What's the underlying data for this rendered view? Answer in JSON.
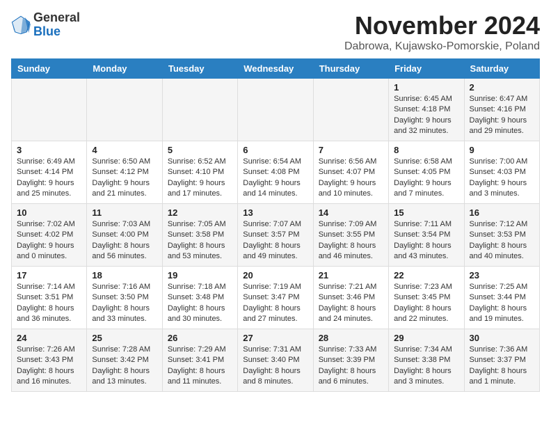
{
  "logo": {
    "general": "General",
    "blue": "Blue"
  },
  "header": {
    "month": "November 2024",
    "location": "Dabrowa, Kujawsko-Pomorskie, Poland"
  },
  "weekdays": [
    "Sunday",
    "Monday",
    "Tuesday",
    "Wednesday",
    "Thursday",
    "Friday",
    "Saturday"
  ],
  "weeks": [
    [
      {
        "day": "",
        "info": ""
      },
      {
        "day": "",
        "info": ""
      },
      {
        "day": "",
        "info": ""
      },
      {
        "day": "",
        "info": ""
      },
      {
        "day": "",
        "info": ""
      },
      {
        "day": "1",
        "info": "Sunrise: 6:45 AM\nSunset: 4:18 PM\nDaylight: 9 hours and 32 minutes."
      },
      {
        "day": "2",
        "info": "Sunrise: 6:47 AM\nSunset: 4:16 PM\nDaylight: 9 hours and 29 minutes."
      }
    ],
    [
      {
        "day": "3",
        "info": "Sunrise: 6:49 AM\nSunset: 4:14 PM\nDaylight: 9 hours and 25 minutes."
      },
      {
        "day": "4",
        "info": "Sunrise: 6:50 AM\nSunset: 4:12 PM\nDaylight: 9 hours and 21 minutes."
      },
      {
        "day": "5",
        "info": "Sunrise: 6:52 AM\nSunset: 4:10 PM\nDaylight: 9 hours and 17 minutes."
      },
      {
        "day": "6",
        "info": "Sunrise: 6:54 AM\nSunset: 4:08 PM\nDaylight: 9 hours and 14 minutes."
      },
      {
        "day": "7",
        "info": "Sunrise: 6:56 AM\nSunset: 4:07 PM\nDaylight: 9 hours and 10 minutes."
      },
      {
        "day": "8",
        "info": "Sunrise: 6:58 AM\nSunset: 4:05 PM\nDaylight: 9 hours and 7 minutes."
      },
      {
        "day": "9",
        "info": "Sunrise: 7:00 AM\nSunset: 4:03 PM\nDaylight: 9 hours and 3 minutes."
      }
    ],
    [
      {
        "day": "10",
        "info": "Sunrise: 7:02 AM\nSunset: 4:02 PM\nDaylight: 9 hours and 0 minutes."
      },
      {
        "day": "11",
        "info": "Sunrise: 7:03 AM\nSunset: 4:00 PM\nDaylight: 8 hours and 56 minutes."
      },
      {
        "day": "12",
        "info": "Sunrise: 7:05 AM\nSunset: 3:58 PM\nDaylight: 8 hours and 53 minutes."
      },
      {
        "day": "13",
        "info": "Sunrise: 7:07 AM\nSunset: 3:57 PM\nDaylight: 8 hours and 49 minutes."
      },
      {
        "day": "14",
        "info": "Sunrise: 7:09 AM\nSunset: 3:55 PM\nDaylight: 8 hours and 46 minutes."
      },
      {
        "day": "15",
        "info": "Sunrise: 7:11 AM\nSunset: 3:54 PM\nDaylight: 8 hours and 43 minutes."
      },
      {
        "day": "16",
        "info": "Sunrise: 7:12 AM\nSunset: 3:53 PM\nDaylight: 8 hours and 40 minutes."
      }
    ],
    [
      {
        "day": "17",
        "info": "Sunrise: 7:14 AM\nSunset: 3:51 PM\nDaylight: 8 hours and 36 minutes."
      },
      {
        "day": "18",
        "info": "Sunrise: 7:16 AM\nSunset: 3:50 PM\nDaylight: 8 hours and 33 minutes."
      },
      {
        "day": "19",
        "info": "Sunrise: 7:18 AM\nSunset: 3:48 PM\nDaylight: 8 hours and 30 minutes."
      },
      {
        "day": "20",
        "info": "Sunrise: 7:19 AM\nSunset: 3:47 PM\nDaylight: 8 hours and 27 minutes."
      },
      {
        "day": "21",
        "info": "Sunrise: 7:21 AM\nSunset: 3:46 PM\nDaylight: 8 hours and 24 minutes."
      },
      {
        "day": "22",
        "info": "Sunrise: 7:23 AM\nSunset: 3:45 PM\nDaylight: 8 hours and 22 minutes."
      },
      {
        "day": "23",
        "info": "Sunrise: 7:25 AM\nSunset: 3:44 PM\nDaylight: 8 hours and 19 minutes."
      }
    ],
    [
      {
        "day": "24",
        "info": "Sunrise: 7:26 AM\nSunset: 3:43 PM\nDaylight: 8 hours and 16 minutes."
      },
      {
        "day": "25",
        "info": "Sunrise: 7:28 AM\nSunset: 3:42 PM\nDaylight: 8 hours and 13 minutes."
      },
      {
        "day": "26",
        "info": "Sunrise: 7:29 AM\nSunset: 3:41 PM\nDaylight: 8 hours and 11 minutes."
      },
      {
        "day": "27",
        "info": "Sunrise: 7:31 AM\nSunset: 3:40 PM\nDaylight: 8 hours and 8 minutes."
      },
      {
        "day": "28",
        "info": "Sunrise: 7:33 AM\nSunset: 3:39 PM\nDaylight: 8 hours and 6 minutes."
      },
      {
        "day": "29",
        "info": "Sunrise: 7:34 AM\nSunset: 3:38 PM\nDaylight: 8 hours and 3 minutes."
      },
      {
        "day": "30",
        "info": "Sunrise: 7:36 AM\nSunset: 3:37 PM\nDaylight: 8 hours and 1 minute."
      }
    ]
  ]
}
